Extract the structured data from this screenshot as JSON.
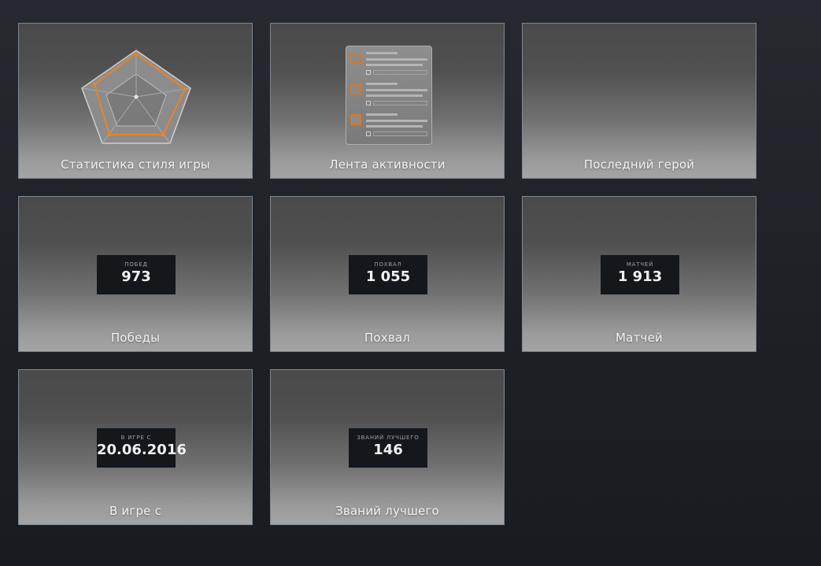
{
  "tiles": [
    {
      "id": "playstyle",
      "label": "Статистика стиля игры"
    },
    {
      "id": "activity",
      "label": "Лента активности"
    },
    {
      "id": "last-hero",
      "label": "Последний герой"
    },
    {
      "id": "wins",
      "label": "Победы",
      "stat_caption": "Побед",
      "stat_value": "973"
    },
    {
      "id": "commends",
      "label": "Похвал",
      "stat_caption": "Похвал",
      "stat_value": "1 055"
    },
    {
      "id": "matches",
      "label": "Матчей",
      "stat_caption": "Матчей",
      "stat_value": "1 913"
    },
    {
      "id": "playing-since",
      "label": "В игре с",
      "stat_caption": "В игре с",
      "stat_value": "20.06.2016"
    },
    {
      "id": "best-ranks",
      "label": "Званий лучшего",
      "stat_caption": "Званий лучшего",
      "stat_value": "146"
    }
  ],
  "colors": {
    "accent": "#e8832a",
    "stat_box": "#14171c",
    "tile_border": "#7f878d",
    "background": "#1e2227"
  },
  "icons": {
    "playstyle": "radar-chart-icon",
    "activity": "activity-feed-icon"
  }
}
